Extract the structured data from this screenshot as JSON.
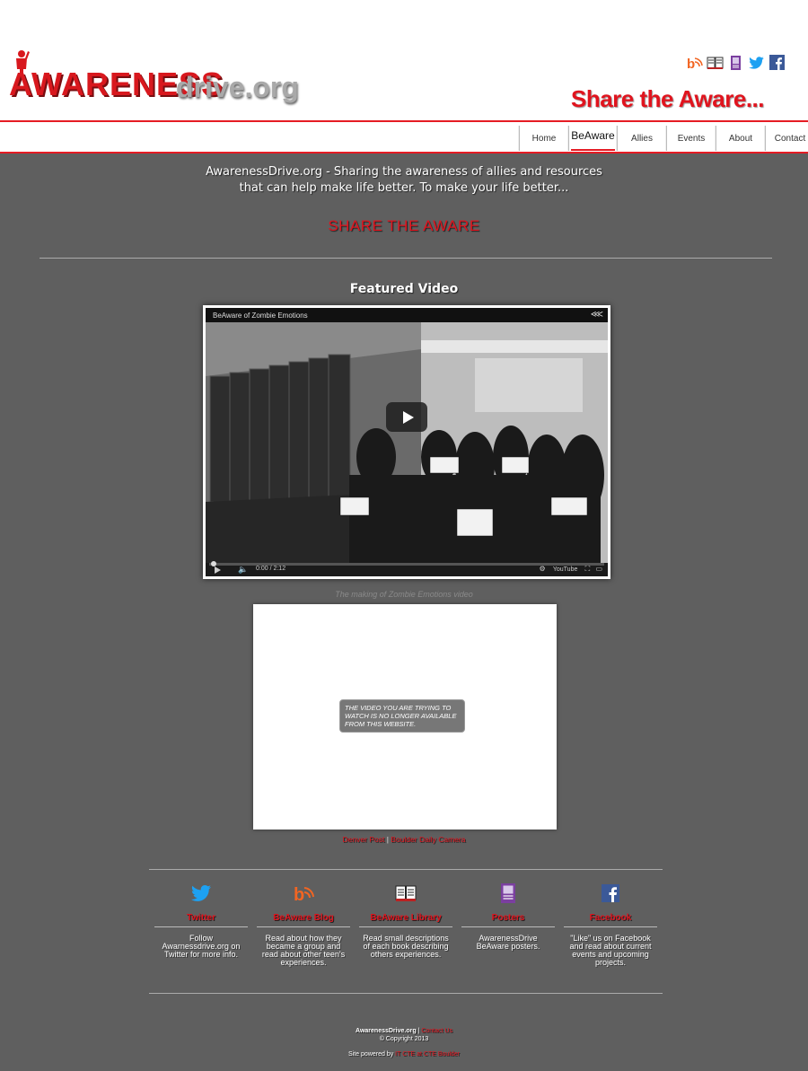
{
  "header": {
    "logo_main": "AWARENESS",
    "logo_suffix": "drive.org",
    "tagline": "Share the Aware...",
    "social_icons": [
      "blog-icon",
      "library-book-icon",
      "poster-icon",
      "twitter-icon",
      "facebook-icon"
    ]
  },
  "nav": {
    "items": [
      {
        "label": "Home"
      },
      {
        "label": "BeAware"
      },
      {
        "label": "Allies"
      },
      {
        "label": "Events"
      },
      {
        "label": "About"
      },
      {
        "label": "Contact"
      }
    ],
    "active": "BeAware"
  },
  "main": {
    "intro_line1": "AwarenessDrive.org - Sharing the awareness of allies and resources",
    "intro_line2": "that can help make life better. To make your life better...",
    "share_heading": "SHARE THE AWARE",
    "featured_title": "Featured Video",
    "video1": {
      "title": "BeAware of Zombie Emotions",
      "time": "0:00 / 2:12",
      "youtube_label": "YouTube"
    },
    "caption": "The making of Zombie Emotions video",
    "video2": {
      "message": "THE VIDEO YOU ARE TRYING TO WATCH IS NO LONGER AVAILABLE FROM THIS WEBSITE."
    },
    "links": {
      "left": "Denver Post",
      "separator": "|",
      "right": "Boulder Daily Camera"
    }
  },
  "columns": [
    {
      "icon": "twitter-icon",
      "title": "Twitter",
      "desc": "Follow Awarnessdrive.org on Twitter for more info."
    },
    {
      "icon": "blog-icon",
      "title": "BeAware Blog",
      "desc": "Read about how they became a group and read about other teen's experiences."
    },
    {
      "icon": "library-book-icon",
      "title": "BeAware Library",
      "desc": "Read small descriptions of each book describing others experiences."
    },
    {
      "icon": "poster-icon",
      "title": "Posters",
      "desc": "AwarenessDrive BeAware posters."
    },
    {
      "icon": "facebook-icon",
      "title": "Facebook",
      "desc": "\"Like\" us on Facebook and read about current events and upcoming projects."
    }
  ],
  "footer": {
    "site_name": "AwarenessDrive.org",
    "separator": "|",
    "contact_link": "Contact Us",
    "copyright": "© Copyright 2013",
    "powered_prefix": "Site powered by",
    "powered_link": "IT CTE at CTE Boulder"
  },
  "colors": {
    "brand_red": "#e0141e",
    "main_bg": "#5f5f5f",
    "twitter_blue": "#1da1f2",
    "facebook_blue": "#3b5998",
    "blog_orange": "#f26522",
    "poster_purple": "#7b3fa0"
  }
}
